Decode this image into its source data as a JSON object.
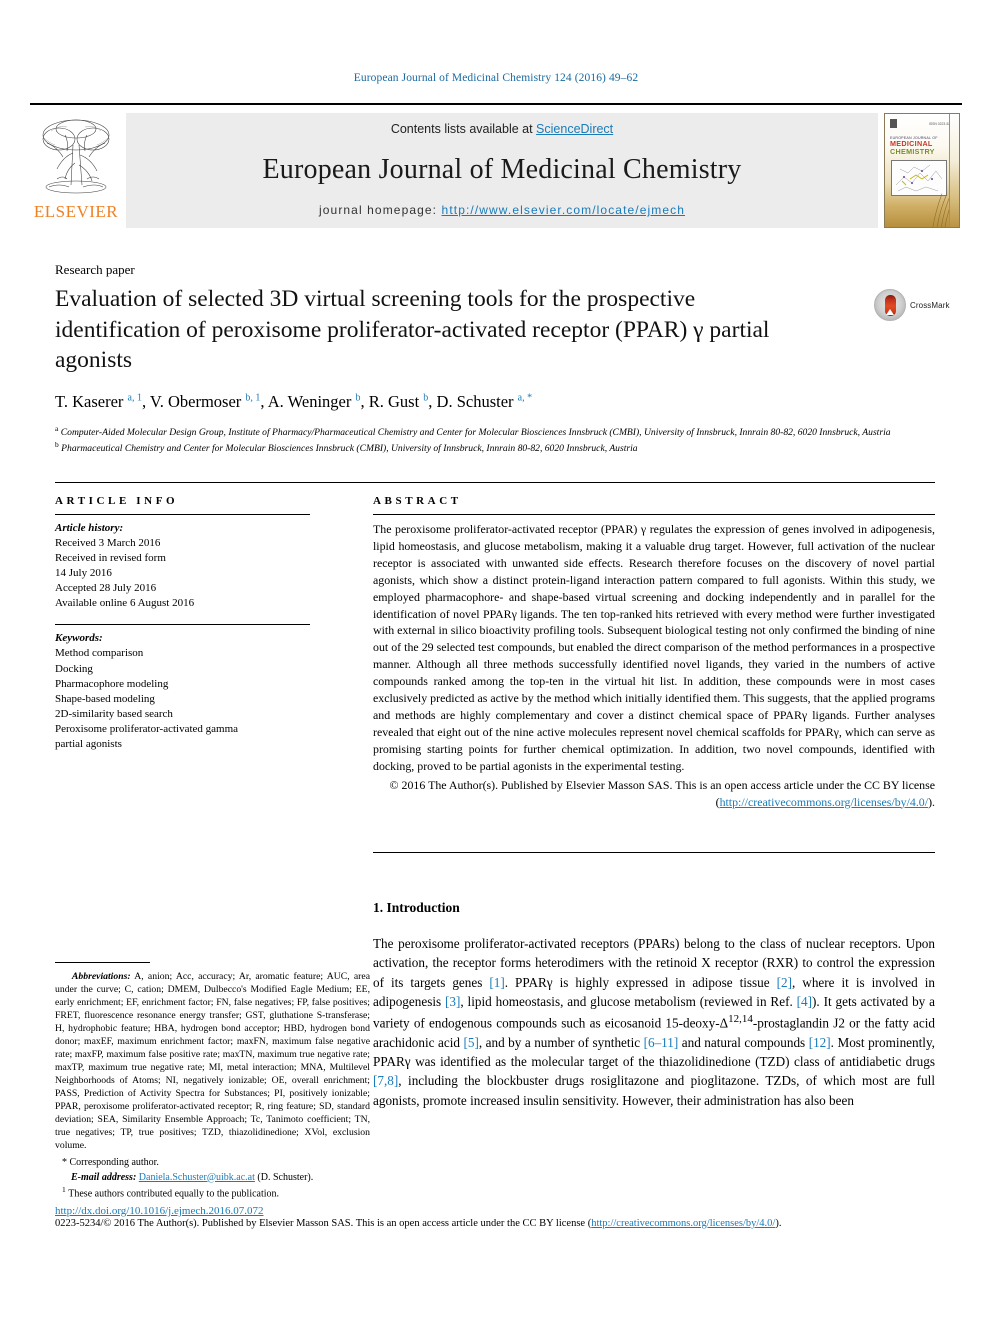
{
  "running_head": "European Journal of Medicinal Chemistry 124 (2016) 49–62",
  "masthead": {
    "publisher": "ELSEVIER",
    "contents_prefix": "Contents lists available at ",
    "contents_link": "ScienceDirect",
    "journal_title": "European Journal of Medicinal Chemistry",
    "homepage_prefix": "journal homepage: ",
    "homepage_url": "http://www.elsevier.com/locate/ejmech",
    "cover": {
      "publisher_small": "ELSEVIER",
      "issn_small": "ISSN 0223-5234",
      "line1": "EUROPEAN JOURNAL OF",
      "line2": "MEDICINAL",
      "line3": "CHEMISTRY"
    }
  },
  "article": {
    "type": "Research paper",
    "title": "Evaluation of selected 3D virtual screening tools for the prospective identification of peroxisome proliferator-activated receptor (PPAR) γ partial agonists",
    "crossmark_label": "CrossMark",
    "authors_html": "T. Kaserer <sup>a, 1</sup>, V. Obermoser <sup>b, 1</sup>, A. Weninger <sup>b</sup>, R. Gust <sup>b</sup>, D. Schuster <sup>a, *</sup>",
    "affiliation_a": "Computer-Aided Molecular Design Group, Institute of Pharmacy/Pharmaceutical Chemistry and Center for Molecular Biosciences Innsbruck (CMBI), University of Innsbruck, Innrain 80-82, 6020 Innsbruck, Austria",
    "affiliation_b": "Pharmaceutical Chemistry and Center for Molecular Biosciences Innsbruck (CMBI), University of Innsbruck, Innrain 80-82, 6020 Innsbruck, Austria"
  },
  "article_info": {
    "heading": "ARTICLE INFO",
    "history_label": "Article history:",
    "history": [
      "Received 3 March 2016",
      "Received in revised form",
      "14 July 2016",
      "Accepted 28 July 2016",
      "Available online 6 August 2016"
    ],
    "keywords_label": "Keywords:",
    "keywords": [
      "Method comparison",
      "Docking",
      "Pharmacophore modeling",
      "Shape-based modeling",
      "2D-similarity based search",
      "Peroxisome proliferator-activated gamma",
      "partial agonists"
    ]
  },
  "abstract": {
    "heading": "ABSTRACT",
    "text": "The peroxisome proliferator-activated receptor (PPAR) γ regulates the expression of genes involved in adipogenesis, lipid homeostasis, and glucose metabolism, making it a valuable drug target. However, full activation of the nuclear receptor is associated with unwanted side effects. Research therefore focuses on the discovery of novel partial agonists, which show a distinct protein-ligand interaction pattern compared to full agonists. Within this study, we employed pharmacophore- and shape-based virtual screening and docking independently and in parallel for the identification of novel PPARγ ligands. The ten top-ranked hits retrieved with every method were further investigated with external in silico bioactivity profiling tools. Subsequent biological testing not only confirmed the binding of nine out of the 29 selected test compounds, but enabled the direct comparison of the method performances in a prospective manner. Although all three methods successfully identified novel ligands, they varied in the numbers of active compounds ranked among the top-ten in the virtual hit list. In addition, these compounds were in most cases exclusively predicted as active by the method which initially identified them. This suggests, that the applied programs and methods are highly complementary and cover a distinct chemical space of PPARγ ligands. Further analyses revealed that eight out of the nine active molecules represent novel chemical scaffolds for PPARγ, which can serve as promising starting points for further chemical optimization. In addition, two novel compounds, identified with docking, proved to be partial agonists in the experimental testing.",
    "copyright": "© 2016 The Author(s). Published by Elsevier Masson SAS. This is an open access article under the CC BY license (",
    "copyright_link": "http://creativecommons.org/licenses/by/4.0/",
    "copyright_tail": ")."
  },
  "introduction": {
    "heading": "1.  Introduction",
    "paragraph_parts": [
      "The peroxisome proliferator-activated receptors (PPARs) belong to the class of nuclear receptors. Upon activation, the receptor forms heterodimers with the retinoid X receptor (RXR) to control the expression of its targets genes ",
      "[1]",
      ". PPARγ is highly expressed in adipose tissue ",
      "[2]",
      ", where it is involved in adipogenesis ",
      "[3]",
      ", lipid homeostasis, and glucose metabolism (reviewed in Ref. ",
      "[4]",
      "). It gets activated by a variety of endogenous compounds such as eicosanoid 15-deoxy-Δ",
      "12,14",
      "-prostaglandin J2 or the fatty acid arachidonic acid ",
      "[5]",
      ", and by a number of synthetic ",
      "[6–11]",
      " and natural compounds ",
      "[12]",
      ". Most prominently, PPARγ was identified as the molecular target of the thiazolidinedione (TZD) class of antidiabetic drugs ",
      "[7,8]",
      ", including the blockbuster drugs rosiglitazone and pioglitazone. TZDs, of which most are full agonists, promote increased insulin sensitivity. However, their administration has also been"
    ]
  },
  "footnotes": {
    "abbrev_label": "Abbreviations:",
    "abbrev_text": " A, anion; Acc, accuracy; Ar, aromatic feature; AUC, area under the curve; C, cation; DMEM, Dulbecco's Modified Eagle Medium; EE, early enrichment; EF, enrichment factor; FN, false negatives; FP, false positives; FRET, fluorescence resonance energy transfer; GST, gluthatione S-transferase; H, hydrophobic feature; HBA, hydrogen bond acceptor; HBD, hydrogen bond donor; maxEF, maximum enrichment factor; maxFN, maximum false negative rate; maxFP, maximum false positive rate; maxTN, maximum true negative rate; maxTP, maximum true negative rate; MI, metal interaction; MNA, Multilevel Neighborhoods of Atoms; NI, negatively ionizable; OE, overall enrichment; PASS, Prediction of Activity Spectra for Substances; PI, positively ionizable; PPAR, peroxisome proliferator-activated receptor; R, ring feature; SD, standard deviation; SEA, Similarity Ensemble Approach; Tc, Tanimoto coefficient; TN, true negatives; TP, true positives; TZD, thiazolidinedione; XVol, exclusion volume.",
    "corresponding_author": "Corresponding author.",
    "email_label": "E-mail address:",
    "email": "Daniela.Schuster@uibk.ac.at",
    "email_suffix": " (D. Schuster).",
    "equal_contribution": "These authors contributed equally to the publication."
  },
  "footer": {
    "doi": "http://dx.doi.org/10.1016/j.ejmech.2016.07.072",
    "issn_line_prefix": "0223-5234/© 2016 The Author(s). Published by Elsevier Masson SAS. This is an open access article under the CC BY license (",
    "issn_line_link": "http://creativecommons.org/licenses/by/4.0/",
    "issn_line_tail": ")."
  },
  "colors": {
    "link_blue": "#1a7bb9",
    "elsevier_orange": "#f08123",
    "crossmark_red": "#d23a18"
  }
}
